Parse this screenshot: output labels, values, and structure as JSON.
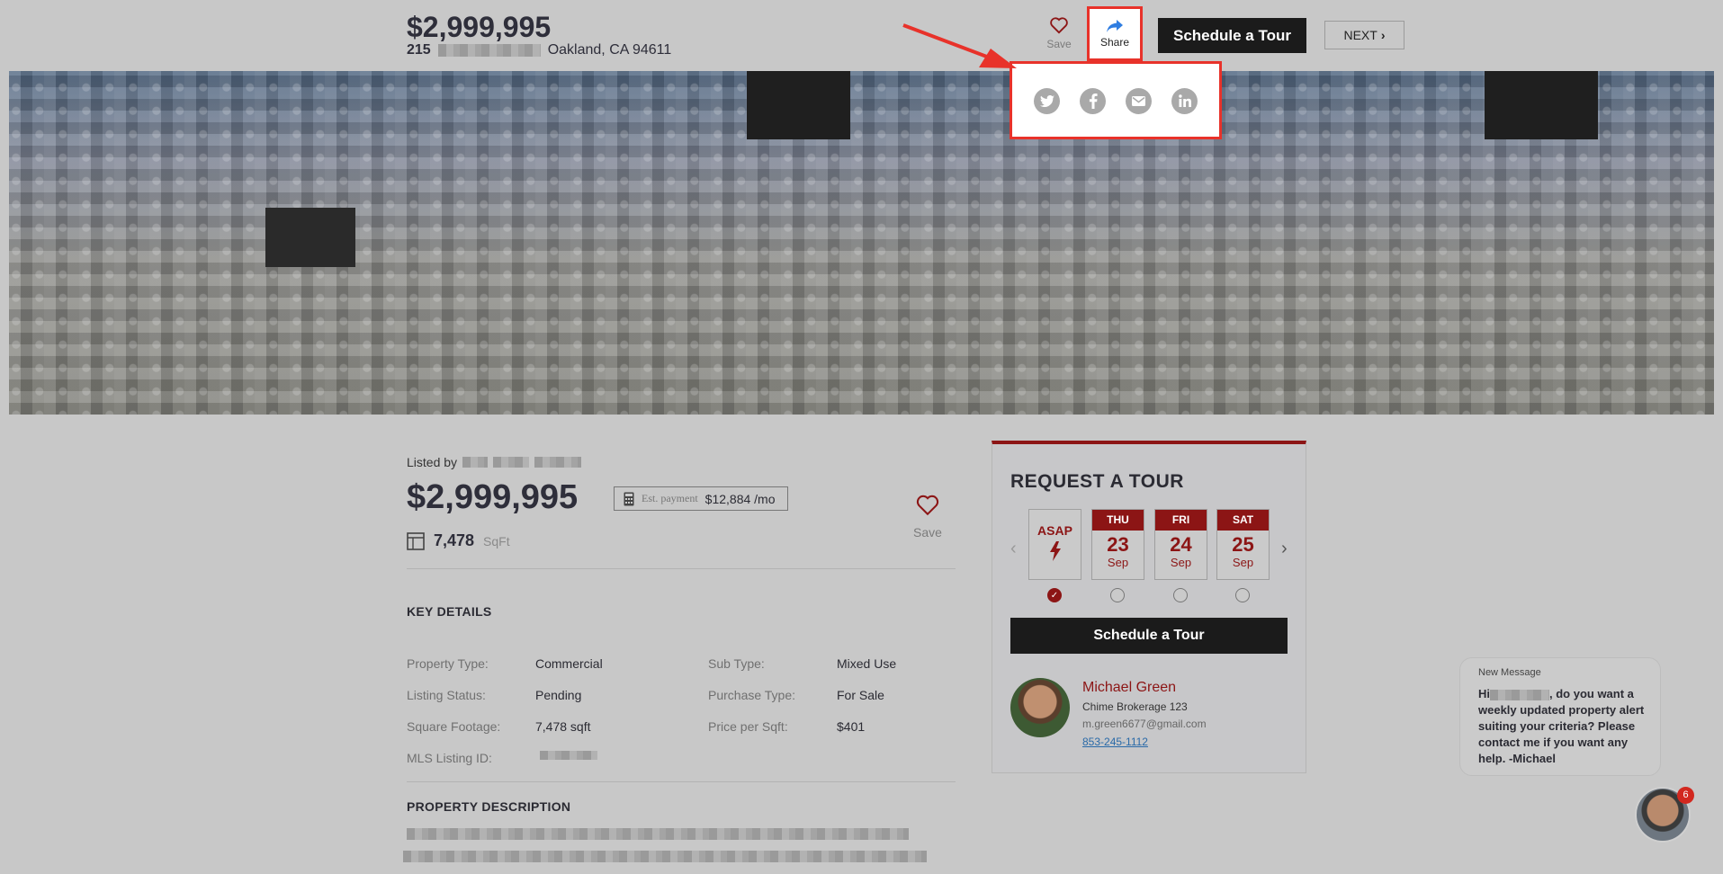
{
  "header": {
    "price": "$2,999,995",
    "address_number": "215",
    "address_city": "Oakland, CA 94611",
    "save_label": "Save",
    "share_label": "Share",
    "schedule_label": "Schedule a Tour",
    "next_label": "NEXT"
  },
  "share_menu": {
    "options": [
      "twitter-icon",
      "facebook-icon",
      "email-icon",
      "linkedin-icon"
    ]
  },
  "listing": {
    "listed_by_label": "Listed by",
    "price": "$2,999,995",
    "est_payment_label": "Est. payment",
    "est_payment_value": "$12,884 /mo",
    "sqft_value": "7,478",
    "sqft_unit": "SqFt",
    "save_label": "Save"
  },
  "key_details": {
    "title": "KEY DETAILS",
    "left": [
      {
        "label": "Property Type:",
        "value": "Commercial"
      },
      {
        "label": "Listing Status:",
        "value": "Pending"
      },
      {
        "label": "Square Footage:",
        "value": "7,478 sqft"
      },
      {
        "label": "MLS Listing ID:",
        "value": ""
      }
    ],
    "right": [
      {
        "label": "Sub Type:",
        "value": "Mixed Use"
      },
      {
        "label": "Purchase Type:",
        "value": "For Sale"
      },
      {
        "label": "Price per Sqft:",
        "value": "$401"
      }
    ]
  },
  "property_description": {
    "title": "PROPERTY DESCRIPTION"
  },
  "tour": {
    "title": "REQUEST A TOUR",
    "asap_label": "ASAP",
    "days": [
      {
        "weekday": "THU",
        "day": "23",
        "month": "Sep"
      },
      {
        "weekday": "FRI",
        "day": "24",
        "month": "Sep"
      },
      {
        "weekday": "SAT",
        "day": "25",
        "month": "Sep"
      }
    ],
    "button_label": "Schedule a Tour",
    "agent": {
      "name": "Michael Green",
      "company": "Chime Brokerage 123",
      "email": "m.green6677@gmail.com",
      "phone": "853-245-1112"
    }
  },
  "chat": {
    "header": "New Message",
    "message_start": "Hi",
    "message_rest": ", do you want a weekly updated property alert suiting your criteria? Please contact me if you want any help. -Michael",
    "badge_count": "6"
  },
  "colors": {
    "accent": "#8c1515",
    "annotation": "#e8322a",
    "dark_button": "#1b1b1b"
  }
}
